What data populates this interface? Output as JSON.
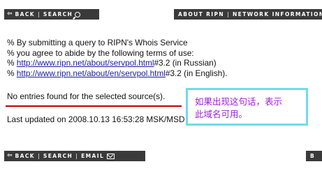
{
  "top_nav_left": {
    "back": "BACK",
    "separator": "|",
    "search": "SEARCH",
    "back_icon": "back-arrow-icon",
    "search_icon": "magnifier-icon"
  },
  "top_nav_right": {
    "about": "ABOUT RIPN",
    "separator": "|",
    "network": "NETWORK INFORMATION"
  },
  "terms": {
    "line1": "% By submitting a query to RIPN's Whois Service",
    "line2": "% you agree to abide by the following terms of use:",
    "line3_prefix": "% ",
    "line3_link": "http://www.ripn.net/about/servpol.html",
    "line3_suffix": "#3.2 (in Russian)",
    "line4_prefix": "% ",
    "line4_link": "http://www.ripn.net/about/en/servpol.html",
    "line4_suffix": "#3.2 (in English)."
  },
  "result": "No entries found for the selected source(s).",
  "last_updated": "Last updated on 2008.10.13 16:53:28 MSK/MSD",
  "callout": {
    "line1": "如果出现这句话，表示",
    "line2": "此域名可用。"
  },
  "bottom_nav_left": {
    "back": "BACK",
    "separator": "|",
    "search": "SEARCH",
    "email": "EMAIL",
    "email_icon": "envelope-icon"
  },
  "bottom_nav_right": {
    "back_partial": "B"
  },
  "colors": {
    "bar": "#3a3a3a",
    "link": "#1a1aa8",
    "underline": "#c00000",
    "callout_border": "#6fdcea",
    "callout_text": "#9a1fd8"
  }
}
